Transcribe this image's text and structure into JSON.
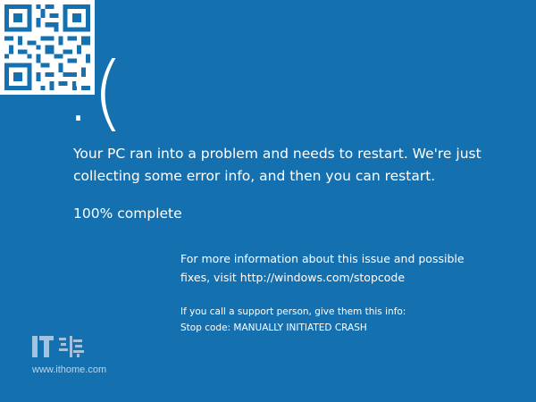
{
  "screen": {
    "background_color": "#1570b0",
    "text_color": "#ffffff",
    "sad_face": ":(",
    "message": "Your PC ran into a problem and needs to restart. We're just collecting some error info, and then you can restart.",
    "progress_text": "100% complete",
    "progress_percent": 100,
    "info_line1": "For more information about this issue and possible",
    "info_line2": "fixes, visit http://windows.com/stopcode",
    "support_line": "If you call a support person, give them this info:",
    "stop_code": "Stop code: MANUALLY INITIATED CRASH"
  },
  "qr_code": {
    "icon": "qr-code-icon"
  },
  "watermark": {
    "logo_text": "IT之家",
    "url": "www.ithome.com"
  }
}
